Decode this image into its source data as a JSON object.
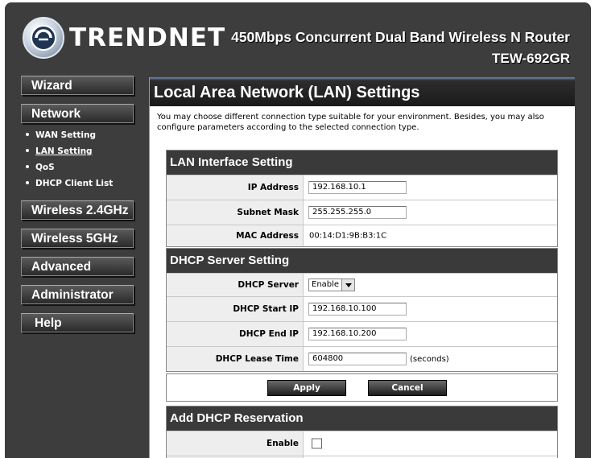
{
  "header": {
    "brand": "TRENDNET",
    "product": "450Mbps Concurrent Dual Band Wireless N Router",
    "model": "TEW-692GR"
  },
  "nav": {
    "wizard": "Wizard",
    "network": "Network",
    "network_items": [
      "WAN Setting",
      "LAN Setting",
      "QoS",
      "DHCP Client List"
    ],
    "wireless24": "Wireless 2.4GHz",
    "wireless5": "Wireless 5GHz",
    "advanced": "Advanced",
    "administrator": "Administrator",
    "help": "Help"
  },
  "page": {
    "title": "Local Area Network (LAN) Settings",
    "intro": "You may choose different connection type suitable for your environment. Besides, you may also configure parameters according to the selected connection type."
  },
  "lan": {
    "heading": "LAN Interface Setting",
    "ip_label": "IP Address",
    "ip_value": "192.168.10.1",
    "mask_label": "Subnet Mask",
    "mask_value": "255.255.255.0",
    "mac_label": "MAC Address",
    "mac_value": "00:14:D1:9B:B3:1C"
  },
  "dhcp": {
    "heading": "DHCP Server Setting",
    "server_label": "DHCP Server",
    "server_value": "Enable",
    "start_label": "DHCP Start IP",
    "start_value": "192.168.10.100",
    "end_label": "DHCP End IP",
    "end_value": "192.168.10.200",
    "lease_label": "DHCP Lease Time",
    "lease_value": "604800",
    "lease_unit": "(seconds)"
  },
  "buttons": {
    "apply": "Apply",
    "cancel": "Cancel"
  },
  "reservation": {
    "heading": "Add DHCP Reservation",
    "enable_label": "Enable",
    "enable_checked": false
  }
}
